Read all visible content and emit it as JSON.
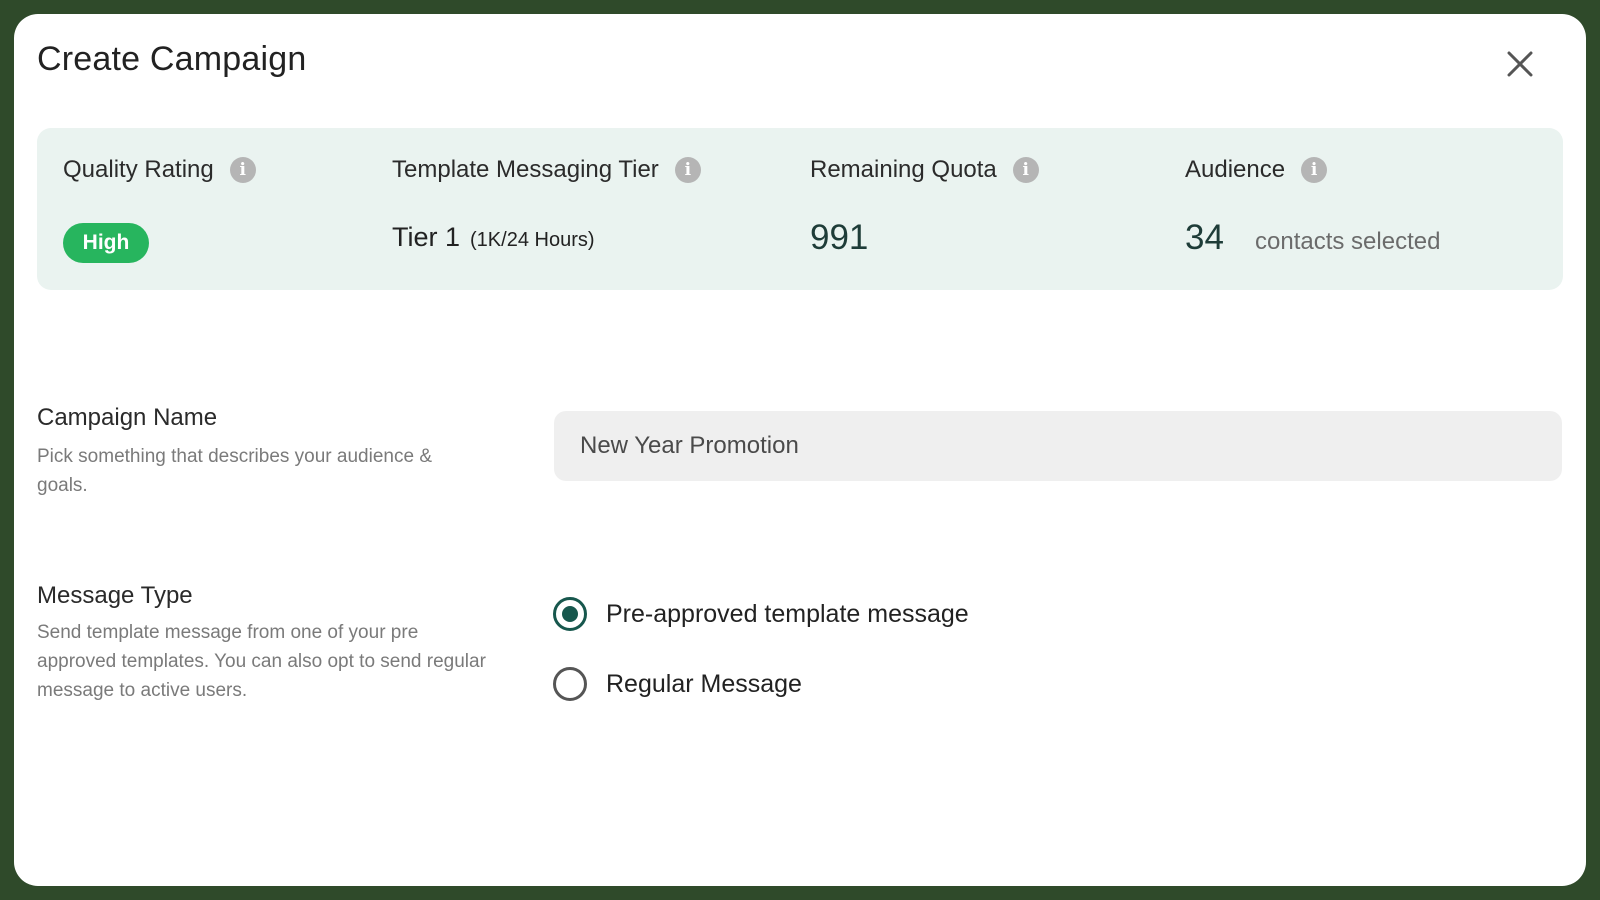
{
  "modal": {
    "title": "Create Campaign",
    "close_icon": "close-icon"
  },
  "stats": {
    "quality": {
      "label": "Quality Rating",
      "value": "High",
      "badge_color": "#27b55e"
    },
    "tier": {
      "label": "Template Messaging Tier",
      "value": "Tier 1",
      "sub": "(1K/24 Hours)"
    },
    "quota": {
      "label": "Remaining Quota",
      "value": "991"
    },
    "audience": {
      "label": "Audience",
      "count": "34",
      "suffix": "contacts selected"
    },
    "info_icon": "info-icon",
    "info_glyph": "i"
  },
  "campaign_name": {
    "title": "Campaign Name",
    "description": "Pick something that describes your audience & goals.",
    "value": "New Year Promotion"
  },
  "message_type": {
    "title": "Message Type",
    "description": "Send template message from one of your pre approved templates. You can also opt to send regular message to active users.",
    "options": [
      {
        "label": "Pre-approved template message",
        "selected": true
      },
      {
        "label": "Regular Message",
        "selected": false
      }
    ]
  },
  "colors": {
    "frame": "#2f4a2a",
    "stats_background": "#eaf3f0",
    "accent": "#17574d"
  }
}
